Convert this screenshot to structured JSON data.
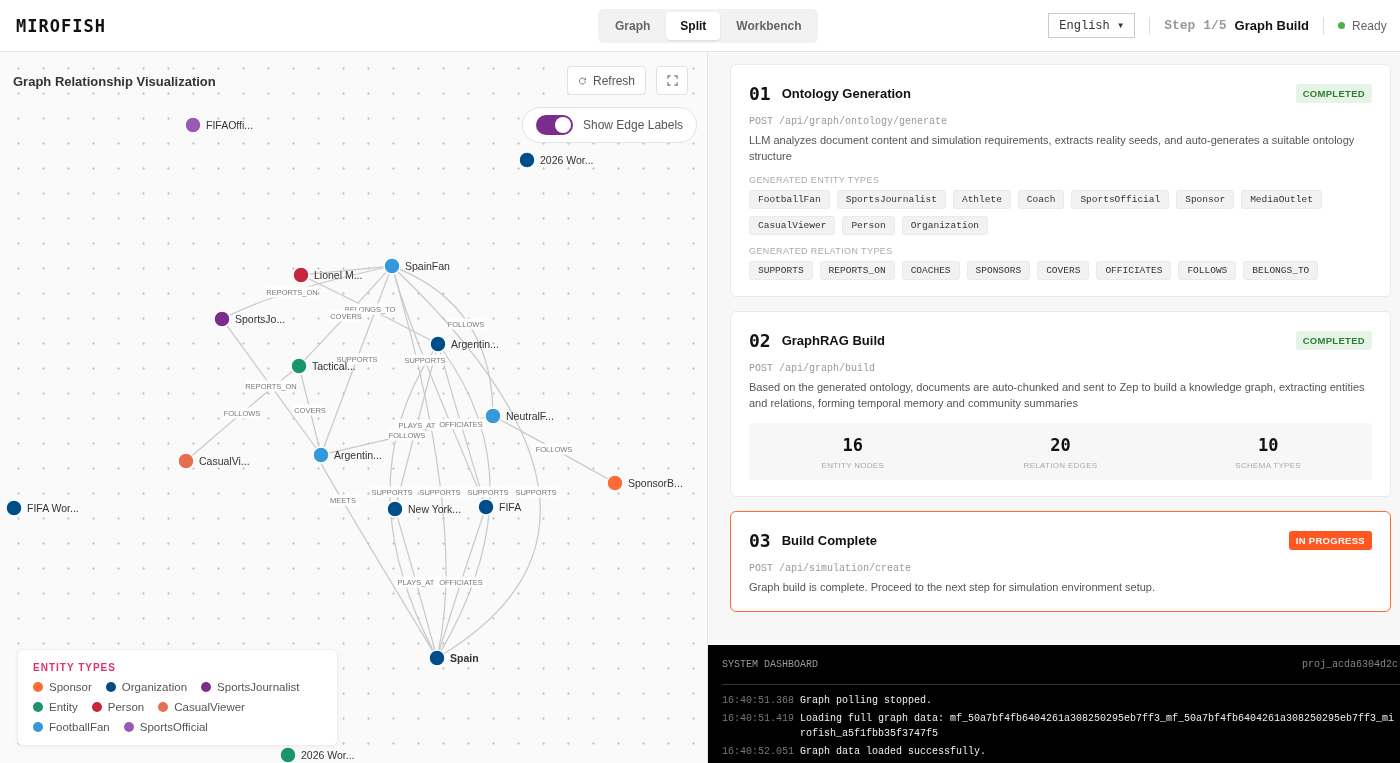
{
  "header": {
    "logo": "MIROFISH",
    "view_tabs": [
      {
        "label": "Graph",
        "selected": false
      },
      {
        "label": "Split",
        "selected": true
      },
      {
        "label": "Workbench",
        "selected": false
      }
    ],
    "language": "English ▾",
    "step": "Step 1/5",
    "step_name": "Graph Build",
    "status": "Ready"
  },
  "graph": {
    "title": "Graph Relationship Visualization",
    "refresh": "Refresh",
    "edge_labels_toggle": {
      "label": "Show Edge Labels",
      "on": true
    },
    "nodes": [
      {
        "label": "FIFAOffi...",
        "color": "#9b59b6"
      },
      {
        "label": "2026 Wor...",
        "color": "#004e89"
      },
      {
        "label": "Lionel M...",
        "color": "#c5283d"
      },
      {
        "label": "SpainFan",
        "color": "#3498db"
      },
      {
        "label": "SportsJo...",
        "color": "#7b2d8e"
      },
      {
        "label": "Argentin...",
        "color": "#004e89"
      },
      {
        "label": "Tactical...",
        "color": "#1a936f"
      },
      {
        "label": "NeutralF...",
        "color": "#3498db"
      },
      {
        "label": "CasualVi...",
        "color": "#e76f51"
      },
      {
        "label": "Argentin...",
        "color": "#3498db"
      },
      {
        "label": "SponsorB...",
        "color": "#ff6b35"
      },
      {
        "label": "FIFA Wor...",
        "color": "#004e89"
      },
      {
        "label": "New York...",
        "color": "#004e89"
      },
      {
        "label": "FIFA",
        "color": "#004e89"
      },
      {
        "label": "Spain",
        "color": "#004e89"
      },
      {
        "label": "2026 Wor...",
        "color": "#1a936f"
      }
    ],
    "edges": [
      {
        "label": "REPORTS_ON"
      },
      {
        "label": "BELONGS_TO"
      },
      {
        "label": "COVERS"
      },
      {
        "label": "SUPPORTS"
      },
      {
        "label": "FOLLOWS"
      },
      {
        "label": "SUPPORTS"
      },
      {
        "label": "REPORTS_ON"
      },
      {
        "label": "COVERS"
      },
      {
        "label": "FOLLOWS"
      },
      {
        "label": "PLAYS_AT"
      },
      {
        "label": "OFFICIATES"
      },
      {
        "label": "FOLLOWS"
      },
      {
        "label": "FOLLOWS"
      },
      {
        "label": "MEETS"
      },
      {
        "label": "SUPPORTS"
      },
      {
        "label": "SUPPORTS"
      },
      {
        "label": "SUPPORTS"
      },
      {
        "label": "SUPPORTS"
      },
      {
        "label": "PLAYS_AT"
      },
      {
        "label": "OFFICIATES"
      }
    ],
    "legend": {
      "title": "ENTITY TYPES",
      "items": [
        {
          "label": "Sponsor",
          "color": "#ff6b35"
        },
        {
          "label": "Organization",
          "color": "#004e89"
        },
        {
          "label": "SportsJournalist",
          "color": "#7b2d8e"
        },
        {
          "label": "Entity",
          "color": "#1a936f"
        },
        {
          "label": "Person",
          "color": "#c5283d"
        },
        {
          "label": "CasualViewer",
          "color": "#e76f51"
        },
        {
          "label": "FootballFan",
          "color": "#3498db"
        },
        {
          "label": "SportsOfficial",
          "color": "#9b59b6"
        }
      ]
    }
  },
  "steps": [
    {
      "number": "01",
      "title": "Ontology Generation",
      "kind": "done",
      "badge": "COMPLETED",
      "endpoint": "POST /api/graph/ontology/generate",
      "description": "LLM analyzes document content and simulation requirements, extracts reality seeds, and auto-generates a suitable ontology structure",
      "sections": [
        {
          "heading": "GENERATED ENTITY TYPES",
          "chips": [
            "FootballFan",
            "SportsJournalist",
            "Athlete",
            "Coach",
            "SportsOfficial",
            "Sponsor",
            "MediaOutlet",
            "CasualViewer",
            "Person",
            "Organization"
          ]
        },
        {
          "heading": "GENERATED RELATION TYPES",
          "chips": [
            "SUPPORTS",
            "REPORTS_ON",
            "COACHES",
            "SPONSORS",
            "COVERS",
            "OFFICIATES",
            "FOLLOWS",
            "BELONGS_TO"
          ]
        }
      ]
    },
    {
      "number": "02",
      "title": "GraphRAG Build",
      "kind": "done",
      "badge": "COMPLETED",
      "endpoint": "POST /api/graph/build",
      "description": "Based on the generated ontology, documents are auto-chunked and sent to Zep to build a knowledge graph, extracting entities and relations, forming temporal memory and community summaries",
      "stats": [
        {
          "value": "16",
          "label": "ENTITY NODES"
        },
        {
          "value": "20",
          "label": "RELATION EDGES"
        },
        {
          "value": "10",
          "label": "SCHEMA TYPES"
        }
      ]
    },
    {
      "number": "03",
      "title": "Build Complete",
      "kind": "active",
      "badge": "IN PROGRESS",
      "endpoint": "POST /api/simulation/create",
      "description": "Graph build is complete. Proceed to the next step for simulation environment setup."
    }
  ],
  "dashboard": {
    "title": "SYSTEM DASHBOARD",
    "project": "proj_acda6304d2c",
    "logs": [
      {
        "time": "16:40:51.368",
        "message": "Graph polling stopped."
      },
      {
        "time": "16:40:51.419",
        "message": "Loading full graph data: mf_50a7bf4fb6404261a308250295eb7ff3_mf_50a7bf4fb6404261a308250295eb7ff3_mirofish_a5f1fbb35f3747f5"
      },
      {
        "time": "16:40:52.051",
        "message": "Graph data loaded successfully."
      }
    ]
  }
}
